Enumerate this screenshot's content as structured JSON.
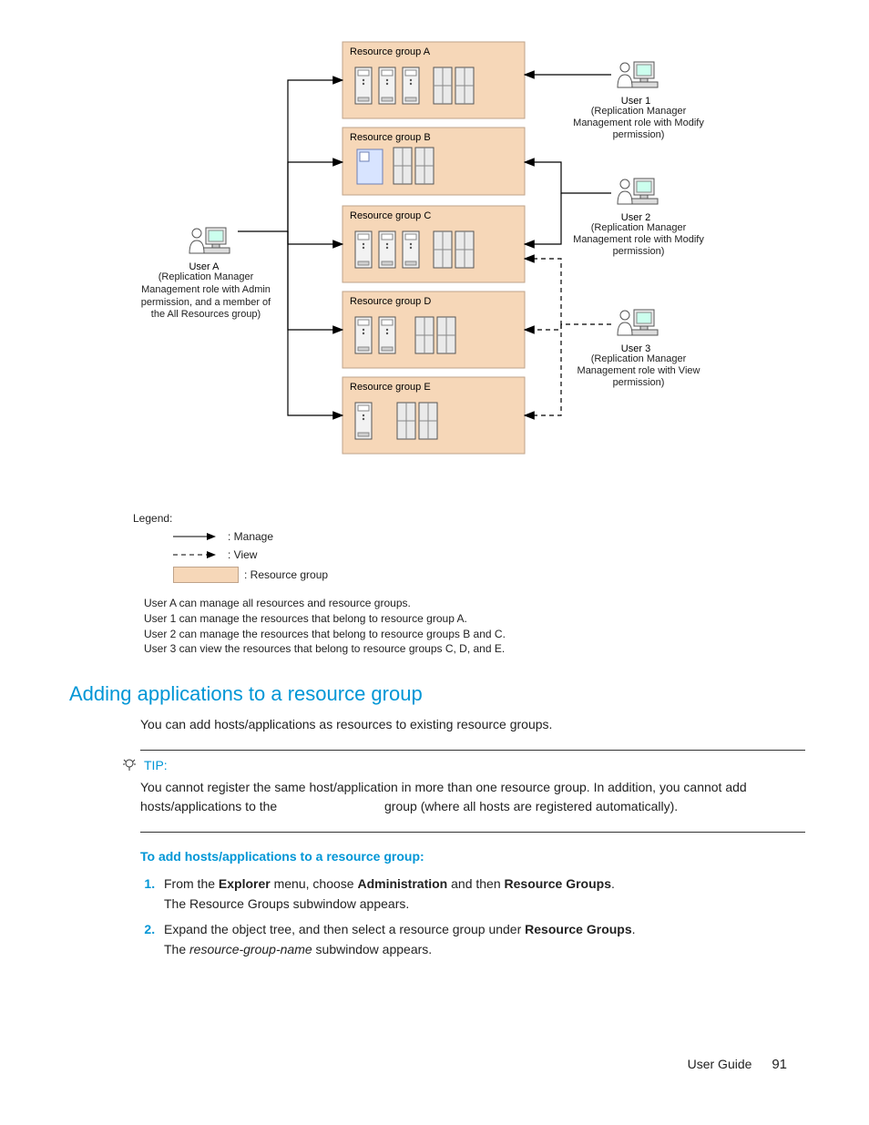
{
  "diagram": {
    "groups": [
      {
        "label": "Resource group A"
      },
      {
        "label": "Resource group B"
      },
      {
        "label": "Resource group C"
      },
      {
        "label": "Resource group D"
      },
      {
        "label": "Resource group E"
      }
    ],
    "userA": {
      "name": "User A",
      "desc": "(Replication Manager Management role with Admin permission, and a member of the All Resources group)"
    },
    "users": [
      {
        "name": "User 1",
        "desc": "(Replication Manager Management role with Modify permission)"
      },
      {
        "name": "User 2",
        "desc": "(Replication Manager Management role with Modify permission)"
      },
      {
        "name": "User 3",
        "desc": "(Replication Manager Management role with View permission)"
      }
    ],
    "legend": {
      "title": "Legend:",
      "manage": ": Manage",
      "view": ": View",
      "rg": ": Resource group"
    },
    "notes": [
      "User A can manage all resources and resource groups.",
      "User 1 can manage the resources that belong to resource group A.",
      "User 2 can manage the resources that belong to resource groups B and C.",
      "User 3 can view the resources that belong to resource groups C, D, and E."
    ]
  },
  "section": {
    "heading": "Adding applications to a resource group",
    "intro": "You can add hosts/applications as resources to existing resource groups.",
    "tip_label": "TIP:",
    "tip_body_1": "You cannot register the same host/application in more than one resource group. In addition, you cannot add hosts/applications to the",
    "tip_body_2": "group (where all hosts are registered automatically).",
    "subhead": "To add hosts/applications to a resource group:",
    "steps": [
      {
        "main_pre": "From the ",
        "b1": "Explorer",
        "mid1": " menu, choose ",
        "b2": "Administration",
        "mid2": " and then ",
        "b3": "Resource Groups",
        "tail": ".",
        "sub": "The Resource Groups subwindow appears."
      },
      {
        "main_pre": "Expand the object tree, and then select a resource group under ",
        "b1": "Resource Groups",
        "tail": ".",
        "sub_pre": "The ",
        "sub_it": "resource-group-name",
        "sub_post": " subwindow appears."
      }
    ]
  },
  "footer": {
    "label": "User Guide",
    "page": "91"
  }
}
